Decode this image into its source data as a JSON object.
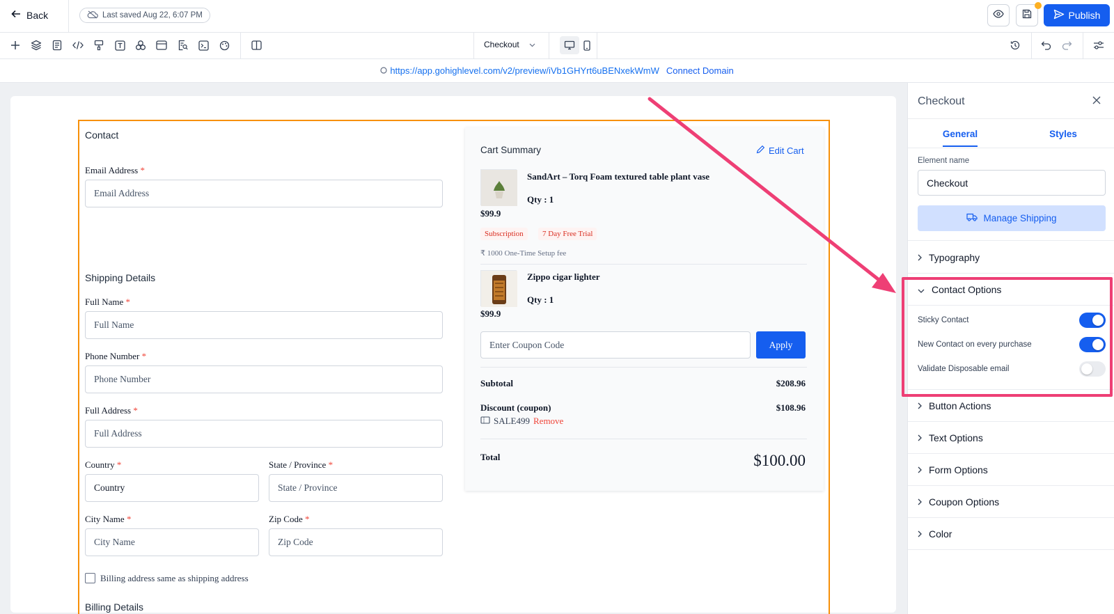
{
  "header": {
    "back_label": "Back",
    "last_saved": "Last saved Aug 22, 6:07 PM",
    "publish_label": "Publish"
  },
  "toolbar": {
    "icons": [
      "plus-icon",
      "layers-icon",
      "page-icon",
      "code-icon",
      "paint-bucket-icon",
      "text-icon",
      "shapes-icon",
      "layout-icon",
      "search-doc-icon",
      "terminal-icon",
      "palette-icon",
      "columns-icon"
    ],
    "page_select": "Checkout",
    "right_icons": [
      "history-icon",
      "undo-icon",
      "redo-icon",
      "settings-sliders-icon"
    ]
  },
  "urlbar": {
    "url": "https://app.gohighlevel.com/v2/preview/iVb1GHYrt6uBENxekWmW",
    "connect_domain": "Connect Domain"
  },
  "form": {
    "contact_title": "Contact",
    "email_label": "Email Address",
    "email_placeholder": "Email Address",
    "shipping_title": "Shipping Details",
    "fullname_label": "Full Name",
    "fullname_placeholder": "Full Name",
    "phone_label": "Phone Number",
    "phone_placeholder": "Phone Number",
    "address_label": "Full Address",
    "address_placeholder": "Full Address",
    "country_label": "Country",
    "country_placeholder": "Country",
    "state_label": "State / Province",
    "state_placeholder": "State / Province",
    "city_label": "City Name",
    "city_placeholder": "City Name",
    "zip_label": "Zip Code",
    "zip_placeholder": "Zip Code",
    "billing_same_label": "Billing address same as shipping address",
    "billing_title": "Billing Details",
    "required_mark": "*"
  },
  "cart": {
    "title": "Cart Summary",
    "edit_cart": "Edit Cart",
    "items": [
      {
        "name": "SandArt – Torq Foam textured table plant vase",
        "qty": "Qty : 1",
        "price": "$99.9",
        "tags": [
          "Subscription",
          "7 Day Free Trial"
        ],
        "setup_fee": "₹ 1000 One-Time Setup fee"
      },
      {
        "name": "Zippo cigar lighter",
        "qty": "Qty : 1",
        "price": "$99.9"
      }
    ],
    "coupon_placeholder": "Enter Coupon Code",
    "apply_label": "Apply",
    "subtotal_label": "Subtotal",
    "subtotal_value": "$208.96",
    "discount_label": "Discount (coupon)",
    "discount_value": "$108.96",
    "coupon_code": "SALE499",
    "remove_label": "Remove",
    "total_label": "Total",
    "total_value": "$100.00"
  },
  "sidebar": {
    "title": "Checkout",
    "tabs": [
      "General",
      "Styles"
    ],
    "active_tab": "General",
    "element_name_label": "Element name",
    "element_name_value": "Checkout",
    "manage_shipping": "Manage Shipping",
    "sections": {
      "typography": "Typography",
      "contact_options": "Contact Options",
      "button_actions": "Button Actions",
      "text_options": "Text Options",
      "form_options": "Form Options",
      "coupon_options": "Coupon Options",
      "color": "Color"
    },
    "contact_toggles": [
      {
        "label": "Sticky Contact",
        "on": true
      },
      {
        "label": "New Contact on every purchase",
        "on": true
      },
      {
        "label": "Validate Disposable email",
        "on": false
      }
    ]
  },
  "colors": {
    "accent": "#155eef",
    "selection_border": "#f79009",
    "highlight": "#ee3f75",
    "required": "#f04438"
  }
}
